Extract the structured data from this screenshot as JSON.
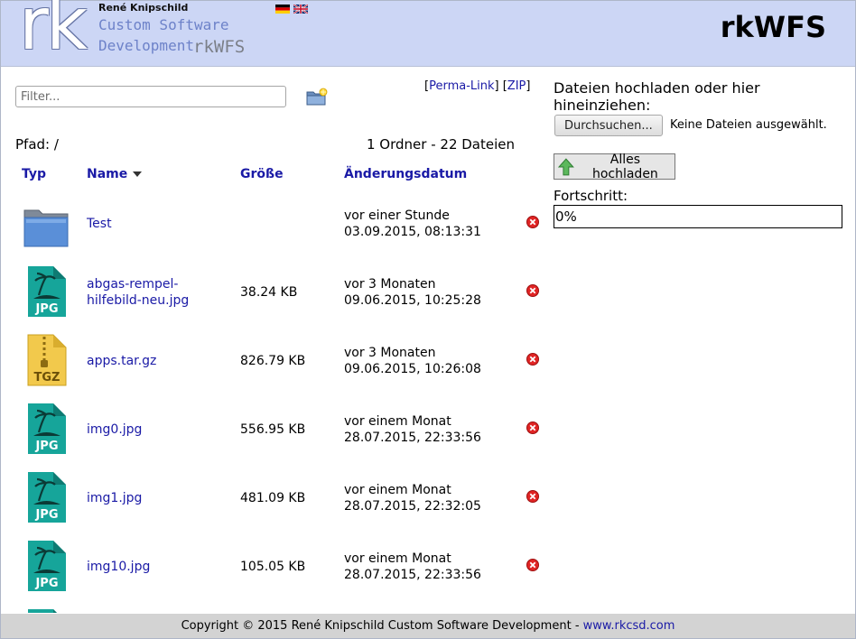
{
  "header": {
    "logo_text": "rk",
    "owner": "René Knipschild",
    "tagline_line1": "Custom Software",
    "tagline_line2": "Development",
    "logo_app": "rkWFS",
    "app_title": "rkWFS",
    "languages": [
      "de",
      "en"
    ]
  },
  "toolbar": {
    "filter_placeholder": "Filter...",
    "perma_link": "Perma-Link",
    "zip": "ZIP"
  },
  "path": {
    "label": "Pfad: /"
  },
  "counts": "1 Ordner - 22 Dateien",
  "columns": {
    "type": "Typ",
    "name": "Name",
    "size": "Größe",
    "date": "Änderungsdatum"
  },
  "files": [
    {
      "type": "folder",
      "name": "Test",
      "size": "",
      "relative": "vor einer Stunde",
      "date": "03.09.2015, 08:13:31"
    },
    {
      "type": "JPG",
      "name": "abgas-rempel-hilfebild-neu.jpg",
      "name_line1": "abgas-rempel-",
      "name_line2": "hilfebild-neu.jpg",
      "size": "38.24 KB",
      "relative": "vor 3 Monaten",
      "date": "09.06.2015, 10:25:28"
    },
    {
      "type": "TGZ",
      "name": "apps.tar.gz",
      "size": "826.79 KB",
      "relative": "vor 3 Monaten",
      "date": "09.06.2015, 10:26:08"
    },
    {
      "type": "JPG",
      "name": "img0.jpg",
      "size": "556.95 KB",
      "relative": "vor einem Monat",
      "date": "28.07.2015, 22:33:56"
    },
    {
      "type": "JPG",
      "name": "img1.jpg",
      "size": "481.09 KB",
      "relative": "vor einem Monat",
      "date": "28.07.2015, 22:32:05"
    },
    {
      "type": "JPG",
      "name": "img10.jpg",
      "size": "105.05 KB",
      "relative": "vor einem Monat",
      "date": "28.07.2015, 22:33:56"
    }
  ],
  "upload": {
    "label": "Dateien hochladen oder hier hineinziehen:",
    "browse": "Durchsuchen...",
    "no_files": "Keine Dateien ausgewählt.",
    "upload_all": "Alles hochladen",
    "progress_label": "Fortschritt:",
    "progress_text": "0%",
    "progress_value": 0
  },
  "footer": {
    "copyright": "Copyright © 2015 René Knipschild Custom Software Development - ",
    "link": "www.rkcsd.com"
  },
  "colors": {
    "header_bg": "#ccd6f5",
    "link": "#1a1aa6",
    "jpg_icon": "#16a59a",
    "tgz_icon": "#f2c94c",
    "folder": "#5a8fd8",
    "delete": "#e02424"
  }
}
